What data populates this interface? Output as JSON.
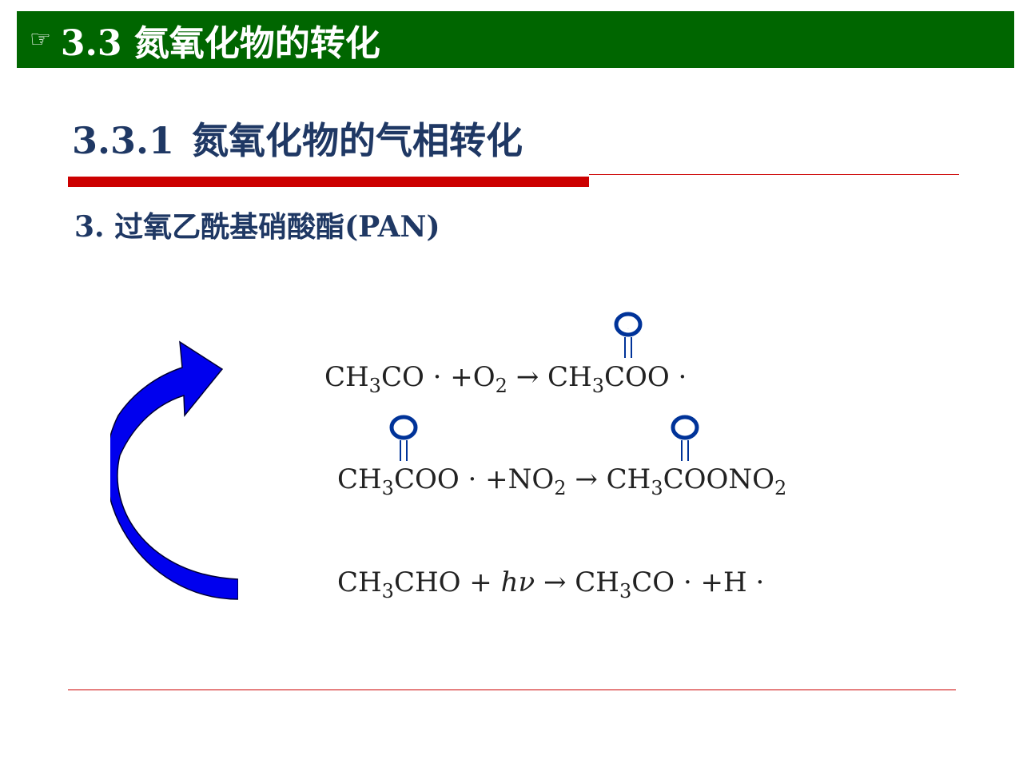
{
  "header": {
    "pointer_icon": "☞",
    "title": "3.3 氮氧化物的转化",
    "color": "#006600"
  },
  "section": {
    "number": "3.3.1",
    "title": "氮氧化物的气相转化",
    "color": "#1f3864"
  },
  "subheading": {
    "text": "3. 过氧乙酰基硝酸酯(PAN)"
  },
  "arrow": {
    "icon": "curved-arrow-icon",
    "color": "#0000ee"
  },
  "equations": [
    {
      "parts": [
        "CH",
        "3",
        "CO · +O",
        "2",
        " → CH",
        "3",
        "COO ·"
      ]
    },
    {
      "parts": [
        "CH",
        "3",
        "COO · +NO",
        "2",
        " → CH",
        "3",
        "COONO",
        "2"
      ]
    },
    {
      "parts": [
        "CH",
        "3",
        "CHO + ",
        "hν",
        " → CH",
        "3",
        "CO · +H ·"
      ]
    }
  ],
  "carbonyl_label": "O",
  "accent_red": "#cc0000"
}
